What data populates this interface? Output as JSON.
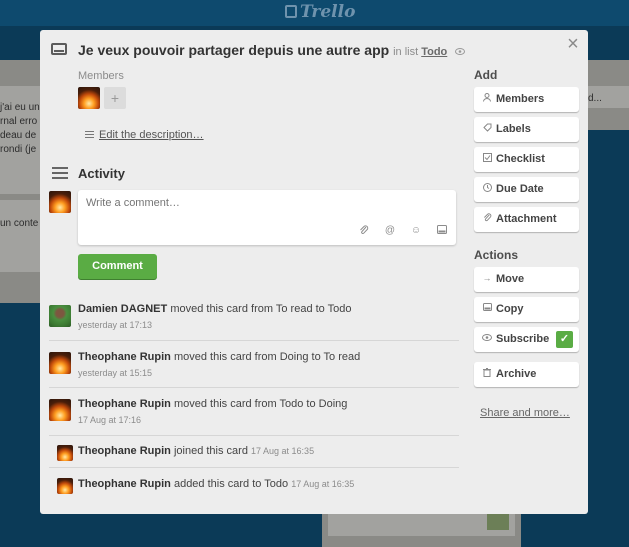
{
  "app": {
    "logo_text": "Trello"
  },
  "background": {
    "left_card_lines": [
      "j'ai eu un",
      "rnal erro",
      "deau de",
      "rondi (je"
    ],
    "left_card2_text": "un conte",
    "right_card_text": "d..."
  },
  "card": {
    "title": "Je veux pouvoir partager depuis une autre app",
    "in_list_prefix": "in list",
    "list_name": "Todo",
    "members_label": "Members",
    "add_member_symbol": "+",
    "description_link": "Edit the description…",
    "close_symbol": "×"
  },
  "activity": {
    "title": "Activity",
    "comment_placeholder": "Write a comment…",
    "comment_button": "Comment",
    "comment_tools": [
      "attachment-icon",
      "mention-icon",
      "emoji-icon",
      "card-link-icon"
    ],
    "items": [
      {
        "user": "Damien DAGNET",
        "action": "moved this card from To read to Todo",
        "time": "yesterday at 17:13",
        "avatar": "green"
      },
      {
        "user": "Theophane Rupin",
        "action": "moved this card from Doing to To read",
        "time": "yesterday at 15:15",
        "avatar": "fire"
      },
      {
        "user": "Theophane Rupin",
        "action": "moved this card from Todo to Doing",
        "time": "17 Aug at 17:16",
        "avatar": "fire"
      },
      {
        "user": "Theophane Rupin",
        "action": "joined this card",
        "time": "17 Aug at 16:35",
        "avatar": "fire"
      },
      {
        "user": "Theophane Rupin",
        "action": "added this card to Todo",
        "time": "17 Aug at 16:35",
        "avatar": "fire"
      }
    ]
  },
  "sidebar": {
    "add_heading": "Add",
    "add_buttons": [
      {
        "label": "Members",
        "icon": "person-icon"
      },
      {
        "label": "Labels",
        "icon": "tag-icon"
      },
      {
        "label": "Checklist",
        "icon": "checkbox-icon"
      },
      {
        "label": "Due Date",
        "icon": "clock-icon"
      },
      {
        "label": "Attachment",
        "icon": "paperclip-icon"
      }
    ],
    "actions_heading": "Actions",
    "action_buttons": [
      {
        "label": "Move",
        "icon": "arrow-right-icon"
      },
      {
        "label": "Copy",
        "icon": "copy-icon"
      },
      {
        "label": "Subscribe",
        "icon": "eye-icon",
        "checked": true
      },
      {
        "label": "Archive",
        "icon": "trash-icon"
      }
    ],
    "share_link": "Share and more…"
  },
  "colors": {
    "accent_green": "#5aac44",
    "modal_bg": "#ededed",
    "board_bg": "#0b3a57"
  }
}
